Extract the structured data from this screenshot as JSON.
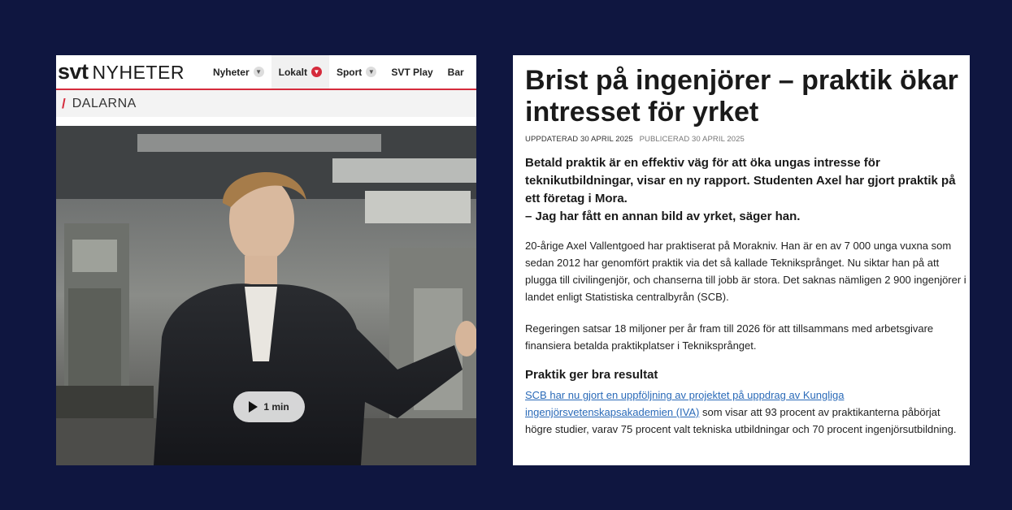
{
  "nav": {
    "logo_svt": "svt",
    "logo_nyheter": "NYHETER",
    "items": [
      {
        "label": "Nyheter"
      },
      {
        "label": "Lokalt"
      },
      {
        "label": "Sport"
      },
      {
        "label": "SVT Play"
      },
      {
        "label": "Bar"
      }
    ]
  },
  "region": {
    "name": "DALARNA"
  },
  "video": {
    "duration_label": "1 min"
  },
  "article": {
    "headline": "Brist på ingenjörer – praktik ökar intresset för yrket",
    "updated": "UPPDATERAD 30 APRIL 2025",
    "published": "PUBLICERAD 30 APRIL 2025",
    "lead_1": "Betald praktik är en effektiv väg för att öka ungas intresse för teknikutbildningar, visar en ny rapport. Studenten Axel har gjort praktik på ett företag i Mora.",
    "lead_2": "– Jag har fått en annan bild av yrket, säger han.",
    "paragraph_1": "20-årige Axel Vallentgoed har praktiserat på Morakniv. Han är en av 7 000 unga vuxna som sedan 2012 har genomfört praktik via det så kallade Tekniksprånget. Nu siktar han på att plugga till civilingenjör, och chanserna till jobb är stora. Det saknas nämligen 2 900 ingenjörer i landet enligt Statistiska centralbyrån (SCB).",
    "paragraph_2": "Regeringen satsar 18 miljoner per år fram till 2026 för att tillsammans med arbetsgivare finansiera betalda praktikplatser i Tekniksprånget.",
    "subheading": "Praktik ger bra resultat",
    "link_text": "SCB har nu gjort en uppföljning av projektet på uppdrag av Kungliga ingenjörsvetenskapsakademien (IVA)",
    "paragraph_3_rest": " som visar att 93 procent av praktikanterna påbörjat högre studier, varav 75 procent valt tekniska utbildningar och 70 procent ingenjörsutbildning."
  },
  "colors": {
    "background": "#0f1640",
    "svt_red": "#d52b3c",
    "link": "#2a6ab8"
  },
  "icons": {
    "chevron": "chevron-down-icon",
    "play": "play-icon"
  }
}
